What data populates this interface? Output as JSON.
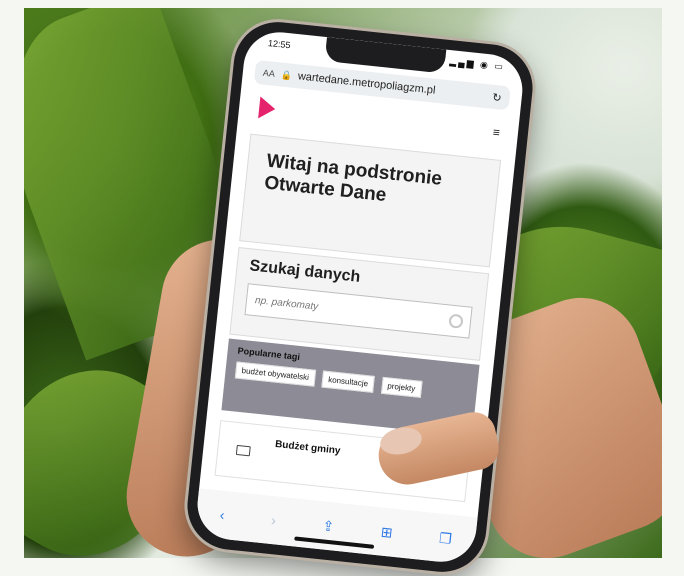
{
  "status": {
    "time": "12:55",
    "icons": "▂▄▆ ◉ ▭"
  },
  "browser": {
    "aa": "AA",
    "url": "wartedane.metropoliagzm.pl"
  },
  "welcome": {
    "title": "Witaj na podstronie Otwarte Dane"
  },
  "search": {
    "title": "Szukaj danych",
    "placeholder": "np. parkomaty"
  },
  "tags": {
    "title": "Popularne tagi",
    "items": [
      "budżet obywatelski",
      "konsultacje",
      "projekty"
    ]
  },
  "budget": {
    "title": "Budżet gminy"
  },
  "colors": {
    "accent": "#e5226c",
    "tags_bg": "#8d8b96",
    "link": "#2f7ae5"
  },
  "icons": [
    "lock-icon",
    "reload-icon",
    "menu-icon",
    "search-icon",
    "folder-icon",
    "back-icon",
    "forward-icon",
    "share-icon",
    "bookmarks-icon",
    "tabs-icon"
  ]
}
